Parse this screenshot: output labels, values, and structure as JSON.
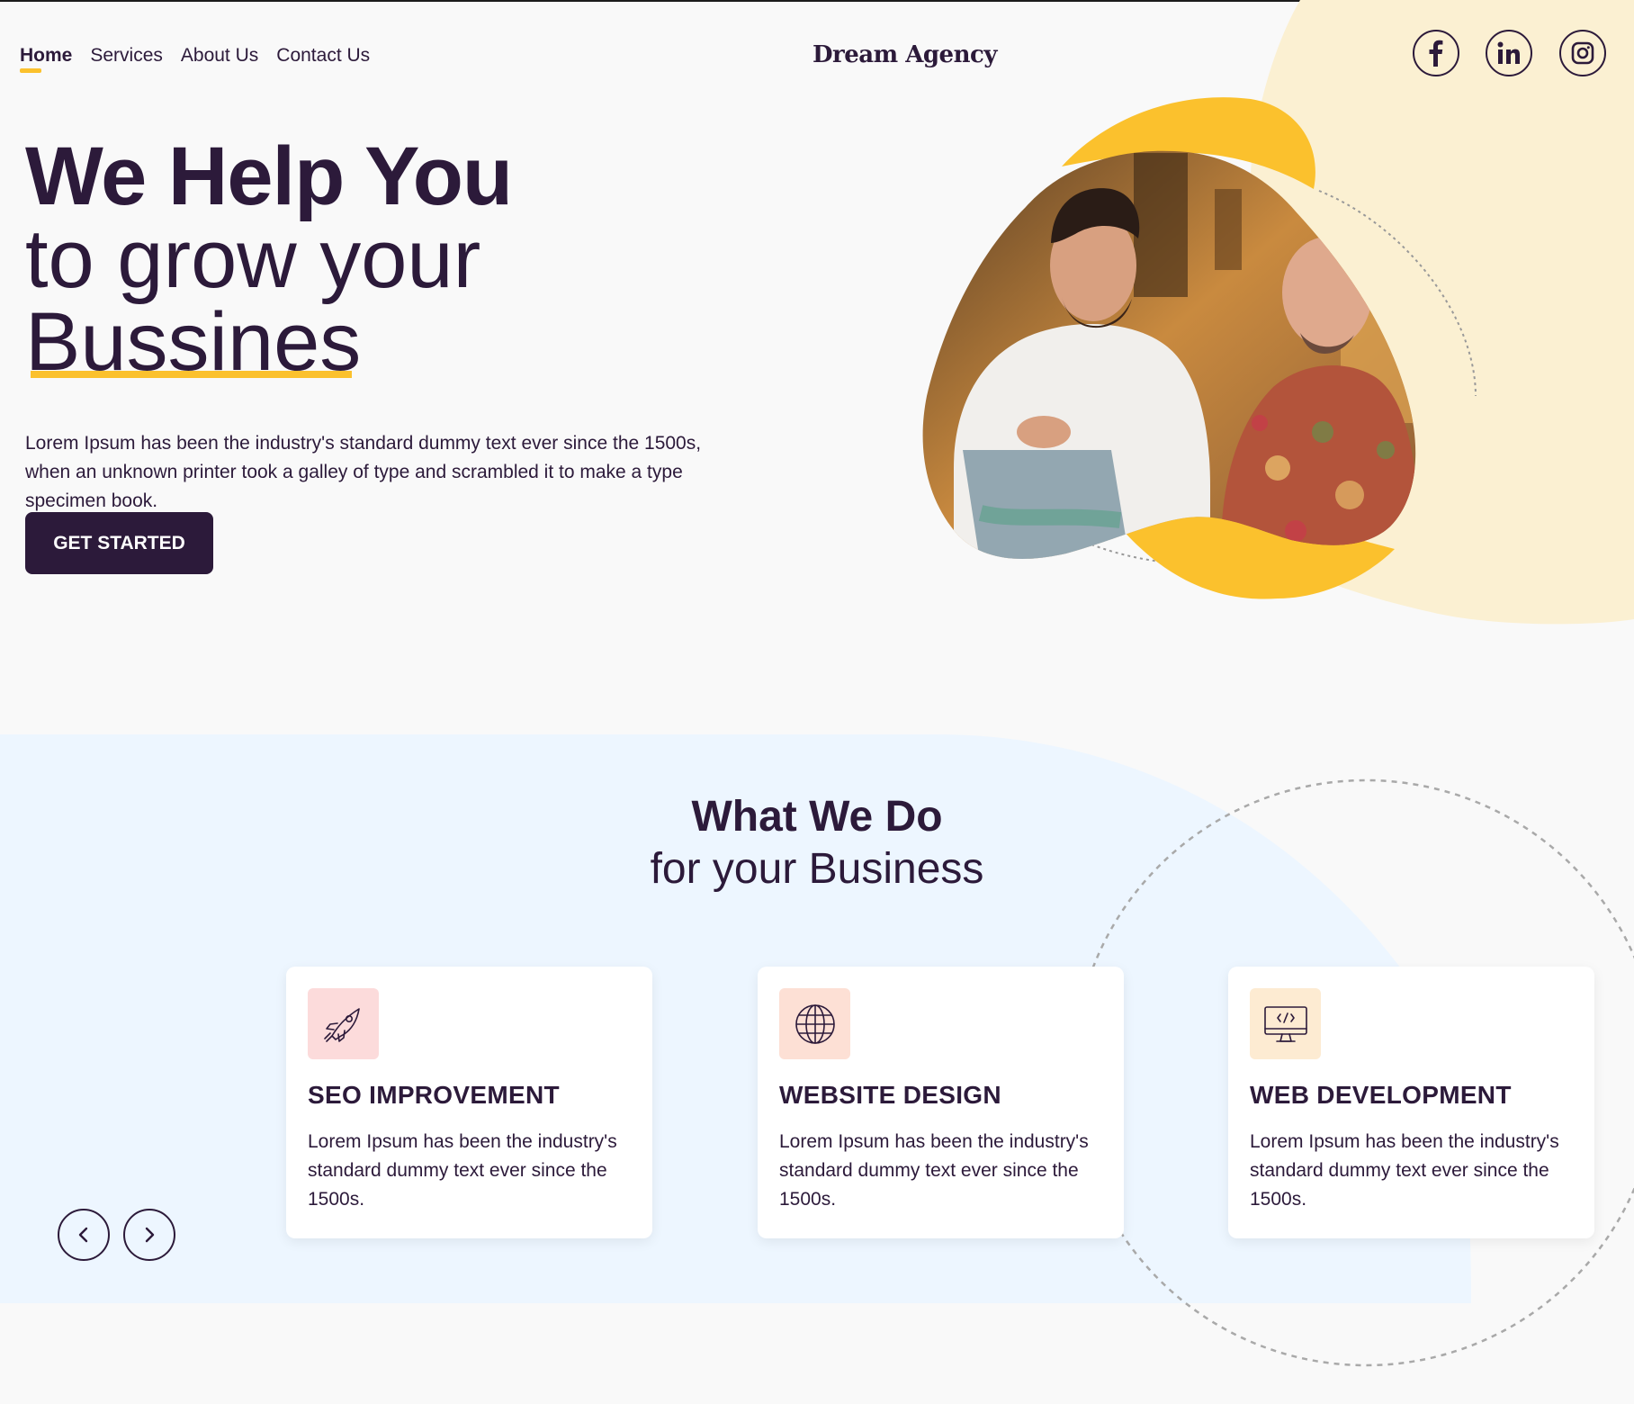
{
  "nav": {
    "items": [
      {
        "label": "Home",
        "active": true
      },
      {
        "label": "Services"
      },
      {
        "label": "About Us"
      },
      {
        "label": "Contact Us"
      }
    ]
  },
  "brand": {
    "name": "Dream Agency"
  },
  "social": [
    "facebook-icon",
    "linkedin-icon",
    "instagram-icon"
  ],
  "hero": {
    "title_bold": "We Help You",
    "title_line2": "to grow your",
    "title_line3": "Bussines",
    "description": "Lorem Ipsum has been the industry's standard dummy text ever since the 1500s, when an unknown printer took a galley of type and scrambled it to make a type specimen book.",
    "cta_label": "GET STARTED"
  },
  "services": {
    "title_bold": "What We Do",
    "title_light_prefix": "for your ",
    "title_light_highlight": "Business",
    "cards": [
      {
        "title": "SEO IMPROVEMENT",
        "text": "Lorem Ipsum has been the industry's standard dummy text ever since the 1500s.",
        "icon": "rocket-icon",
        "icon_bg": "#fcdbdb"
      },
      {
        "title": "WEBSITE DESIGN",
        "text": "Lorem Ipsum has been the industry's standard dummy text ever since the 1500s.",
        "icon": "globe-icon",
        "icon_bg": "#fde0d5"
      },
      {
        "title": "WEB DEVELOPMENT",
        "text": "Lorem Ipsum has been the industry's standard dummy text ever since the 1500s.",
        "icon": "monitor-code-icon",
        "icon_bg": "#fdebd2"
      }
    ]
  },
  "colors": {
    "primary": "#2c1a3a",
    "accent": "#fbc12d",
    "hero_blob": "#fbf0d2",
    "services_bg": "#edf6ff"
  }
}
